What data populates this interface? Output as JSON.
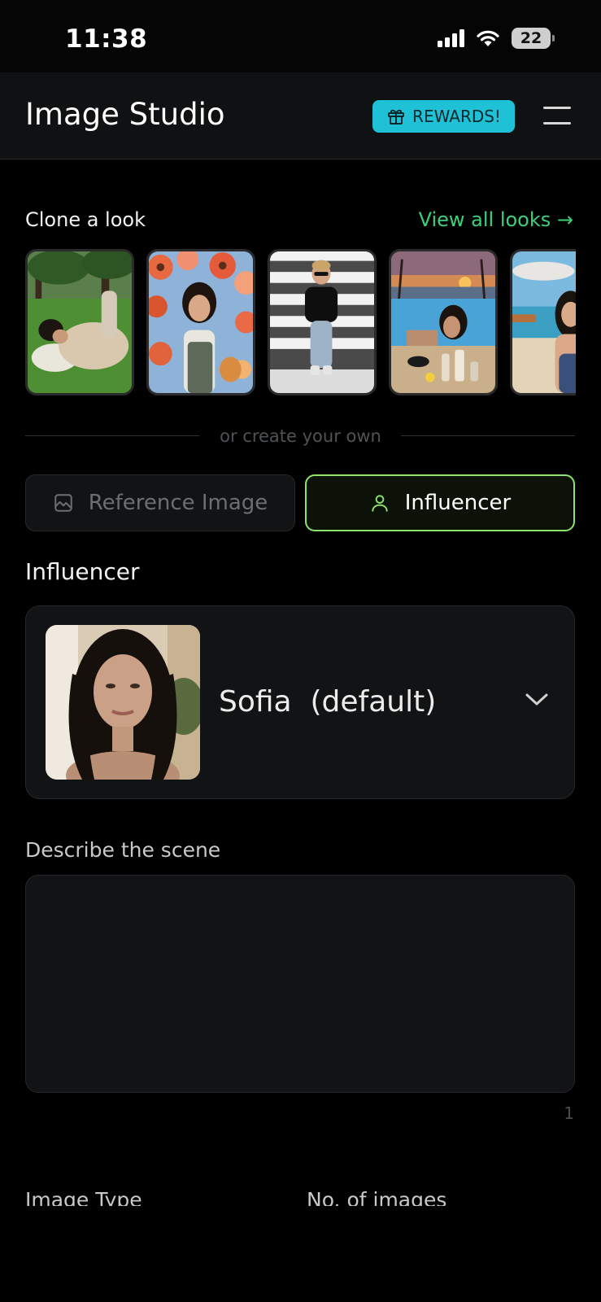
{
  "status_bar": {
    "time": "11:38",
    "battery": "22"
  },
  "header": {
    "title": "Image Studio",
    "rewards_label": "REWARDS!"
  },
  "clone": {
    "title": "Clone a look",
    "view_all": "View all looks →"
  },
  "divider": {
    "text": "or create your own"
  },
  "mode_toggle": {
    "reference_label": "Reference Image",
    "influencer_label": "Influencer",
    "selected": "Influencer"
  },
  "influencer": {
    "section_label": "Influencer",
    "selected_name": "Sofia  (default)"
  },
  "scene": {
    "label": "Describe the scene",
    "value": "",
    "char_count": "1"
  },
  "bottom": {
    "image_type_label": "Image Type",
    "num_images_label": "No. of images"
  },
  "colors": {
    "accent_green": "#8de36b",
    "link_green": "#3ecf7a",
    "rewards_cyan": "#1fc1d6"
  }
}
